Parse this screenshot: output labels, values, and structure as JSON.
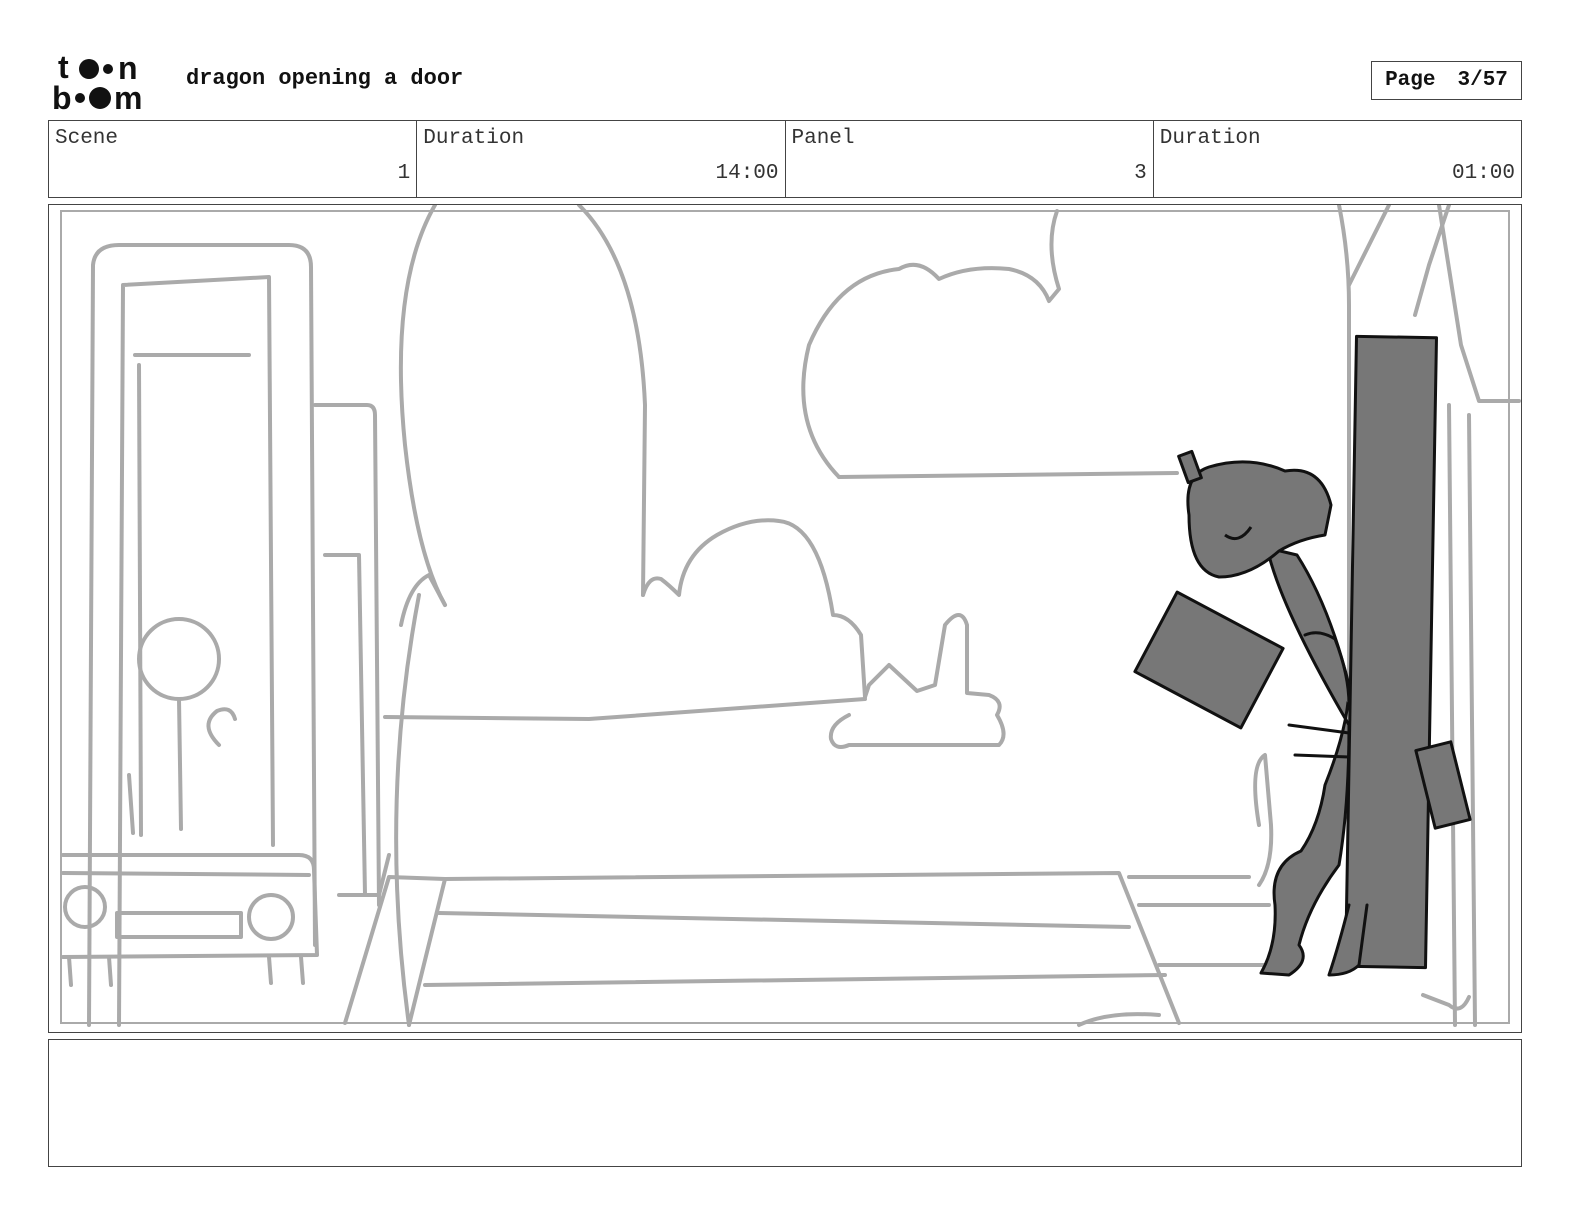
{
  "header": {
    "logo_text": "toon boom",
    "title": "dragon opening a door",
    "page_label": "Page",
    "page_value": "3/57"
  },
  "info": {
    "scene_label": "Scene",
    "scene_value": "1",
    "scene_duration_label": "Duration",
    "scene_duration_value": "14:00",
    "panel_label": "Panel",
    "panel_value": "3",
    "panel_duration_label": "Duration",
    "panel_duration_value": "01:00"
  },
  "notes": {
    "text": ""
  }
}
